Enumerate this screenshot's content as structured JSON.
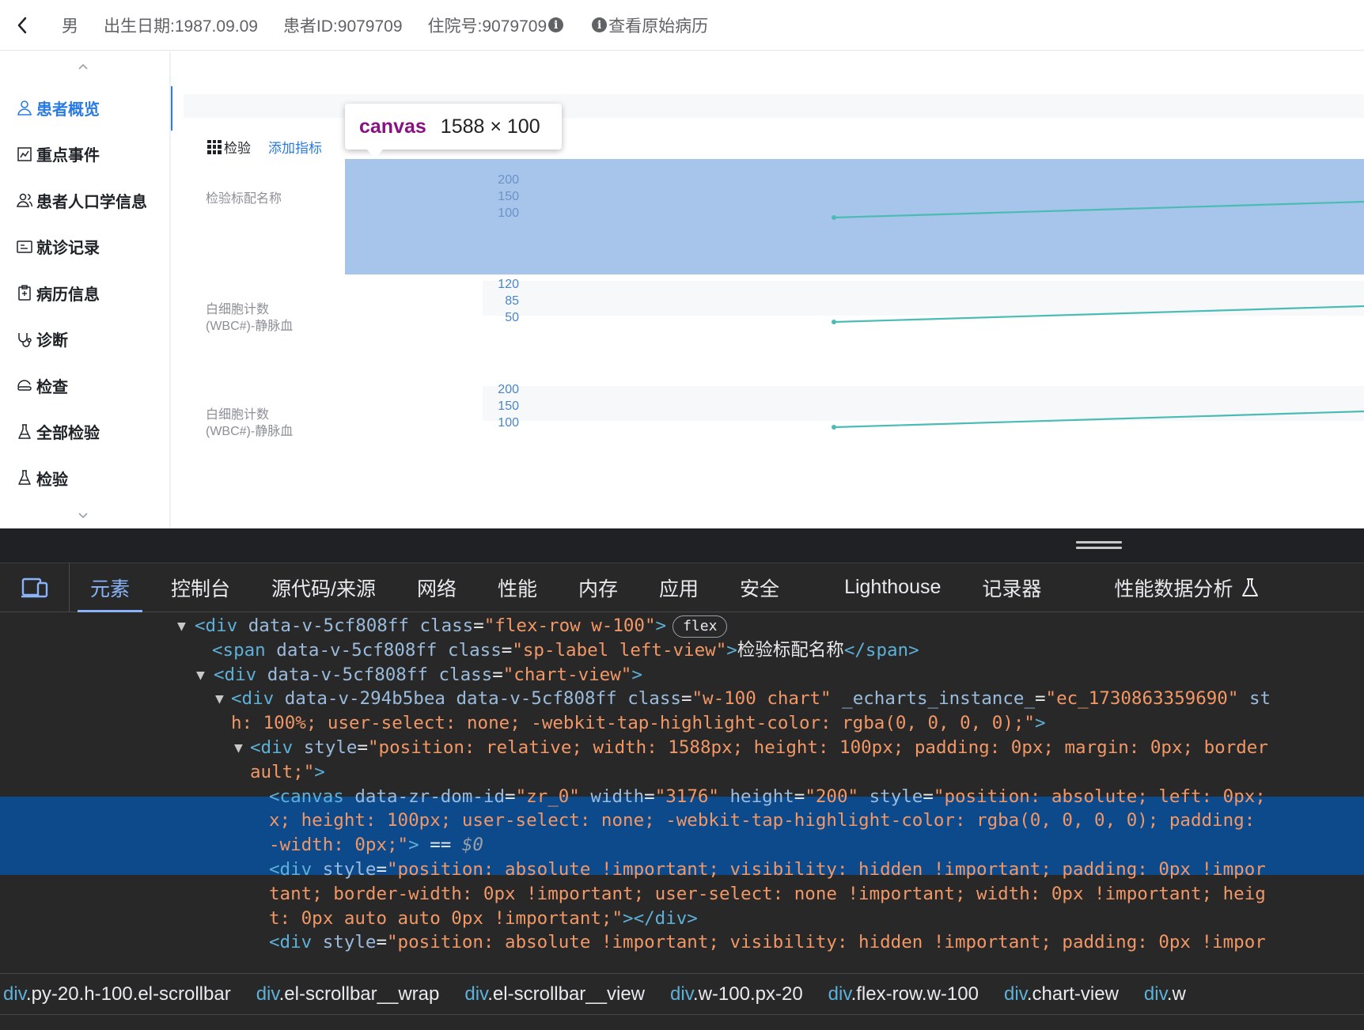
{
  "header": {
    "gender": "男",
    "birth_date": "出生日期:1987.09.09",
    "patient_id": "患者ID:9079709",
    "admission_no": "住院号:9079709",
    "info_mark": "i",
    "view_original": "查看原始病历"
  },
  "sidebar": {
    "items": [
      {
        "label": "患者概览",
        "icon": "person-icon",
        "active": true
      },
      {
        "label": "重点事件",
        "icon": "chart-doc-icon",
        "active": false
      },
      {
        "label": "患者人口学信息",
        "icon": "people-icon",
        "active": false
      },
      {
        "label": "就诊记录",
        "icon": "id-card-icon",
        "active": false
      },
      {
        "label": "病历信息",
        "icon": "clipboard-icon",
        "active": false
      },
      {
        "label": "诊断",
        "icon": "stethoscope-icon",
        "active": false
      },
      {
        "label": "检查",
        "icon": "scan-icon",
        "active": false
      },
      {
        "label": "全部检验",
        "icon": "flask-icon",
        "active": false
      },
      {
        "label": "检验",
        "icon": "flask-icon",
        "active": false
      }
    ]
  },
  "lab_panel": {
    "title": "检验",
    "add_metric": "添加指标",
    "rows": [
      {
        "label": "检验标配名称",
        "y_ticks": [
          "200",
          "150",
          "100"
        ],
        "series_color": "#4bbcb4"
      },
      {
        "label": "白细胞计数\n(WBC#)-静脉血",
        "y_ticks": [
          "120",
          "85",
          "50"
        ],
        "series_color": "#4bbcb4"
      },
      {
        "label": "白细胞计数\n(WBC#)-静脉血",
        "y_ticks": [
          "200",
          "150",
          "100"
        ],
        "series_color": "#4bbcb4"
      }
    ]
  },
  "inspect_tooltip": {
    "tag": "canvas",
    "size": "1588 × 100"
  },
  "devtools": {
    "tabs": [
      "元素",
      "控制台",
      "源代码/来源",
      "网络",
      "性能",
      "内存",
      "应用",
      "安全",
      "Lighthouse",
      "记录器",
      "性能数据分析"
    ],
    "active_tab": "元素",
    "flex_badge": "flex",
    "code_lines": [
      {
        "tokens": [
          [
            "tg",
            "<div "
          ],
          [
            "at",
            "data-v-5cf808ff "
          ],
          [
            "at",
            "class"
          ],
          [
            "tx",
            "="
          ],
          [
            "av",
            "\"flex-row w-100\""
          ],
          [
            "tg",
            ">"
          ]
        ]
      },
      {
        "tokens": [
          [
            "tg",
            "<span "
          ],
          [
            "at",
            "data-v-5cf808ff "
          ],
          [
            "at",
            "class"
          ],
          [
            "tx",
            "="
          ],
          [
            "av",
            "\"sp-label left-view\""
          ],
          [
            "tg",
            ">"
          ],
          [
            "tx",
            "检验标配名称"
          ],
          [
            "tg",
            "</span>"
          ]
        ]
      },
      {
        "tokens": [
          [
            "tg",
            "<div "
          ],
          [
            "at",
            "data-v-5cf808ff "
          ],
          [
            "at",
            "class"
          ],
          [
            "tx",
            "="
          ],
          [
            "av",
            "\"chart-view\""
          ],
          [
            "tg",
            ">"
          ]
        ]
      },
      {
        "tokens": [
          [
            "tg",
            "<div "
          ],
          [
            "at",
            "data-v-294b5bea data-v-5cf808ff "
          ],
          [
            "at",
            "class"
          ],
          [
            "tx",
            "="
          ],
          [
            "av",
            "\"w-100 chart\" "
          ],
          [
            "at",
            "_echarts_instance_"
          ],
          [
            "tx",
            "="
          ],
          [
            "av",
            "\"ec_1730863359690\" "
          ],
          [
            "at",
            "st"
          ]
        ]
      },
      {
        "tokens": [
          [
            "av",
            "h: 100%; user-select: none; -webkit-tap-highlight-color: rgba(0, 0, 0, 0);\""
          ],
          [
            "tg",
            ">"
          ]
        ]
      },
      {
        "tokens": [
          [
            "tg",
            "<div "
          ],
          [
            "at",
            "style"
          ],
          [
            "tx",
            "="
          ],
          [
            "av",
            "\"position: relative; width: 1588px; height: 100px; padding: 0px; margin: 0px; border"
          ]
        ]
      },
      {
        "tokens": [
          [
            "av",
            "ault;\""
          ],
          [
            "tg",
            ">"
          ]
        ]
      },
      {
        "tokens": [
          [
            "tg",
            "<canvas "
          ],
          [
            "at",
            "data-zr-dom-id"
          ],
          [
            "tx",
            "="
          ],
          [
            "av",
            "\"zr_0\" "
          ],
          [
            "at",
            "width"
          ],
          [
            "tx",
            "="
          ],
          [
            "av",
            "\"3176\" "
          ],
          [
            "at",
            "height"
          ],
          [
            "tx",
            "="
          ],
          [
            "av",
            "\"200\" "
          ],
          [
            "at",
            "style"
          ],
          [
            "tx",
            "="
          ],
          [
            "av",
            "\"position: absolute; left: 0px;"
          ]
        ]
      },
      {
        "tokens": [
          [
            "av",
            "x; height: 100px; user-select: none; -webkit-tap-highlight-color: rgba(0, 0, 0, 0); padding: "
          ]
        ]
      },
      {
        "tokens": [
          [
            "av",
            "-width: 0px;\""
          ],
          [
            "tg",
            ">"
          ],
          [
            "tx",
            " == "
          ],
          [
            "dl",
            "$0"
          ]
        ]
      },
      {
        "tokens": [
          [
            "tg",
            "<div "
          ],
          [
            "at",
            "style"
          ],
          [
            "tx",
            "="
          ],
          [
            "av",
            "\"position: absolute !important; visibility: hidden !important; padding: 0px !impor"
          ]
        ]
      },
      {
        "tokens": [
          [
            "av",
            "tant; border-width: 0px !important; user-select: none !important; width: 0px !important; heig"
          ]
        ]
      },
      {
        "tokens": [
          [
            "av",
            "t: 0px auto auto 0px !important;\""
          ],
          [
            "tg",
            ">"
          ],
          [
            "tg",
            "</div>"
          ]
        ]
      },
      {
        "tokens": [
          [
            "tg",
            "<div "
          ],
          [
            "at",
            "style"
          ],
          [
            "tx",
            "="
          ],
          [
            "av",
            "\"position: absolute !important; visibility: hidden !important; padding: 0px !impor"
          ]
        ]
      }
    ],
    "breadcrumbs": [
      {
        "tag": "div",
        "cls": ".py-20.h-100.el-scrollbar"
      },
      {
        "tag": "div",
        "cls": ".el-scrollbar__wrap"
      },
      {
        "tag": "div",
        "cls": ".el-scrollbar__view"
      },
      {
        "tag": "div",
        "cls": ".w-100.px-20"
      },
      {
        "tag": "div",
        "cls": ".flex-row.w-100"
      },
      {
        "tag": "div",
        "cls": ".chart-view"
      },
      {
        "tag": "div",
        "cls": ".w"
      }
    ]
  },
  "colors": {
    "accent": "#2a7be4",
    "selection": "#0d4a8c",
    "highlight": "#a7c4ea",
    "series": "#4bbcb4",
    "axis_label": "#4a86c9"
  }
}
